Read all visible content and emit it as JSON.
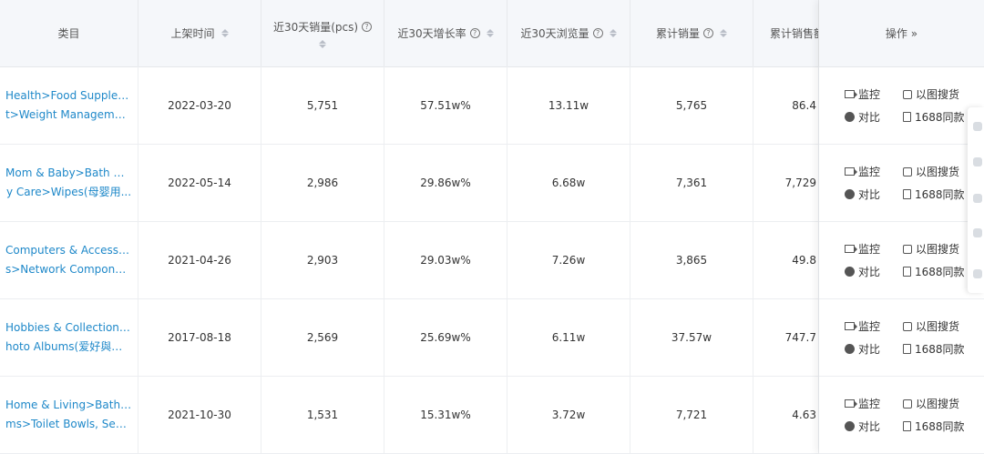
{
  "headers": {
    "category": "类目",
    "listed": "上架时间",
    "sales30": "近30天销量(pcs)",
    "growth30": "近30天增长率",
    "views30": "近30天浏览量",
    "cumSales": "累计销量",
    "cumRevenue": "累计销售额",
    "ops": "操作 »"
  },
  "ops_labels": {
    "monitor": "监控",
    "image_search": "以图搜货",
    "compare": "对比",
    "same_1688": "1688同款"
  },
  "rows": [
    {
      "cat1": "Health>Food Supplemen",
      "cat2": "t>Weight Management..",
      "date": "2022-03-20",
      "sales": "5,751",
      "growth": "57.51w%",
      "views": "13.11w",
      "cum": "5,765",
      "rev": "86.4"
    },
    {
      "cat1": "Mom & Baby>Bath & Bod",
      "cat2": "y Care>Wipes(母婴用...",
      "date": "2022-05-14",
      "sales": "2,986",
      "growth": "29.86w%",
      "views": "6.68w",
      "cum": "7,361",
      "rev": "7,729"
    },
    {
      "cat1": "Computers & Accessorie",
      "cat2": "s>Network Component...",
      "date": "2021-04-26",
      "sales": "2,903",
      "growth": "29.03w%",
      "views": "7.26w",
      "cum": "3,865",
      "rev": "49.8"
    },
    {
      "cat1": "Hobbies & Collections>P",
      "cat2": "hoto Albums(爱好與收...",
      "date": "2017-08-18",
      "sales": "2,569",
      "growth": "25.69w%",
      "views": "6.11w",
      "cum": "37.57w",
      "rev": "747.7"
    },
    {
      "cat1": "Home & Living>Bathroo",
      "cat2": "ms>Toilet Bowls, Seats...",
      "date": "2021-10-30",
      "sales": "1,531",
      "growth": "15.31w%",
      "views": "3.72w",
      "cum": "7,721",
      "rev": "4.63"
    }
  ]
}
